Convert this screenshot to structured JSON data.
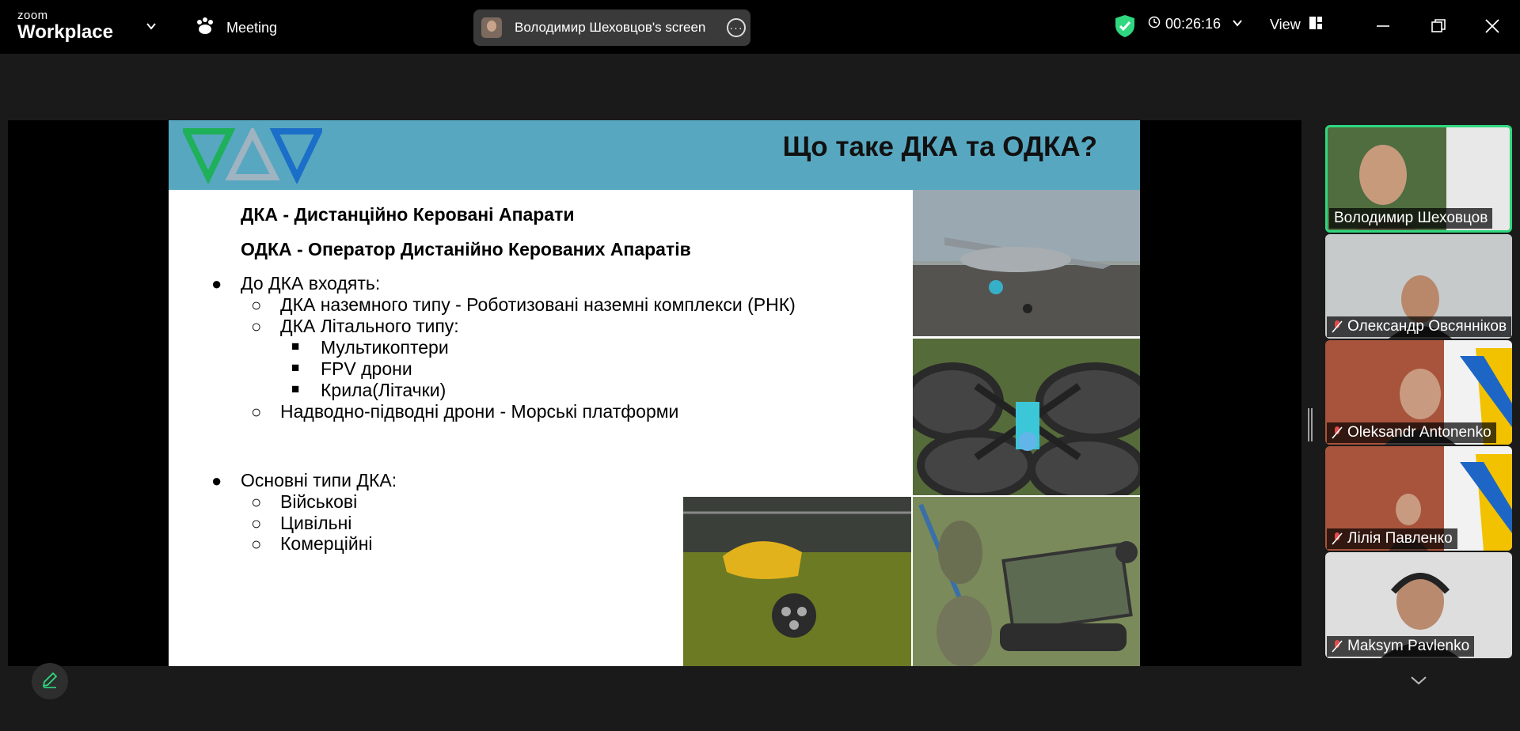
{
  "app": {
    "logo_small": "zoom",
    "logo_big": "Workplace"
  },
  "topbar": {
    "meeting_label": "Meeting",
    "share_label": "Володимир Шеховцов's screen",
    "timer": "00:26:16",
    "view_label": "View"
  },
  "slide": {
    "title": "Що таке ДКА та ОДКА?",
    "def1": "ДКА - Дистанційно Керовані Апарати",
    "def2": "ОДКА - Оператор Дистанійно Керованих Апаратів",
    "section1": "До ДКА входять:",
    "sub1": "ДКА наземного типу - Роботизовані наземні комплекси (РНК)",
    "sub2": "ДКА Літального типу:",
    "subsub1": "Мультикоптери",
    "subsub2": "FPV дрони",
    "subsub3": "Крила(Літачки)",
    "sub3": "Надводно-підводні дрони -  Морські платформи",
    "section2": "Основні типи ДКА:",
    "types": [
      "Військові",
      "Цивільні",
      "Комерційні"
    ],
    "bullets": {
      "filled": "●",
      "hollow": "○",
      "square": "■"
    }
  },
  "participants": [
    {
      "name": "Володимир Шеховцов",
      "muted": false,
      "active": true
    },
    {
      "name": "Олександр Овсянніков",
      "muted": true,
      "active": false
    },
    {
      "name": "Oleksandr Antonenko",
      "muted": true,
      "active": false
    },
    {
      "name": "Лілія Павленко",
      "muted": true,
      "active": false
    },
    {
      "name": "Maksym Pavlenko",
      "muted": true,
      "active": false
    }
  ],
  "colors": {
    "active_border": "#2fd87f",
    "shield": "#2fd87f",
    "slide_header": "#58a7c0"
  }
}
